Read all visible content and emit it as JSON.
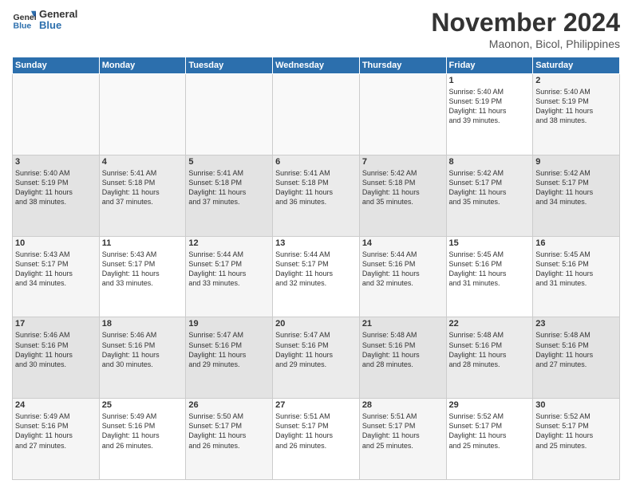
{
  "logo": {
    "line1": "General",
    "line2": "Blue"
  },
  "title": "November 2024",
  "subtitle": "Maonon, Bicol, Philippines",
  "days_header": [
    "Sunday",
    "Monday",
    "Tuesday",
    "Wednesday",
    "Thursday",
    "Friday",
    "Saturday"
  ],
  "weeks": [
    [
      {
        "day": "",
        "info": ""
      },
      {
        "day": "",
        "info": ""
      },
      {
        "day": "",
        "info": ""
      },
      {
        "day": "",
        "info": ""
      },
      {
        "day": "",
        "info": ""
      },
      {
        "day": "1",
        "info": "Sunrise: 5:40 AM\nSunset: 5:19 PM\nDaylight: 11 hours\nand 39 minutes."
      },
      {
        "day": "2",
        "info": "Sunrise: 5:40 AM\nSunset: 5:19 PM\nDaylight: 11 hours\nand 38 minutes."
      }
    ],
    [
      {
        "day": "3",
        "info": "Sunrise: 5:40 AM\nSunset: 5:19 PM\nDaylight: 11 hours\nand 38 minutes."
      },
      {
        "day": "4",
        "info": "Sunrise: 5:41 AM\nSunset: 5:18 PM\nDaylight: 11 hours\nand 37 minutes."
      },
      {
        "day": "5",
        "info": "Sunrise: 5:41 AM\nSunset: 5:18 PM\nDaylight: 11 hours\nand 37 minutes."
      },
      {
        "day": "6",
        "info": "Sunrise: 5:41 AM\nSunset: 5:18 PM\nDaylight: 11 hours\nand 36 minutes."
      },
      {
        "day": "7",
        "info": "Sunrise: 5:42 AM\nSunset: 5:18 PM\nDaylight: 11 hours\nand 35 minutes."
      },
      {
        "day": "8",
        "info": "Sunrise: 5:42 AM\nSunset: 5:17 PM\nDaylight: 11 hours\nand 35 minutes."
      },
      {
        "day": "9",
        "info": "Sunrise: 5:42 AM\nSunset: 5:17 PM\nDaylight: 11 hours\nand 34 minutes."
      }
    ],
    [
      {
        "day": "10",
        "info": "Sunrise: 5:43 AM\nSunset: 5:17 PM\nDaylight: 11 hours\nand 34 minutes."
      },
      {
        "day": "11",
        "info": "Sunrise: 5:43 AM\nSunset: 5:17 PM\nDaylight: 11 hours\nand 33 minutes."
      },
      {
        "day": "12",
        "info": "Sunrise: 5:44 AM\nSunset: 5:17 PM\nDaylight: 11 hours\nand 33 minutes."
      },
      {
        "day": "13",
        "info": "Sunrise: 5:44 AM\nSunset: 5:17 PM\nDaylight: 11 hours\nand 32 minutes."
      },
      {
        "day": "14",
        "info": "Sunrise: 5:44 AM\nSunset: 5:16 PM\nDaylight: 11 hours\nand 32 minutes."
      },
      {
        "day": "15",
        "info": "Sunrise: 5:45 AM\nSunset: 5:16 PM\nDaylight: 11 hours\nand 31 minutes."
      },
      {
        "day": "16",
        "info": "Sunrise: 5:45 AM\nSunset: 5:16 PM\nDaylight: 11 hours\nand 31 minutes."
      }
    ],
    [
      {
        "day": "17",
        "info": "Sunrise: 5:46 AM\nSunset: 5:16 PM\nDaylight: 11 hours\nand 30 minutes."
      },
      {
        "day": "18",
        "info": "Sunrise: 5:46 AM\nSunset: 5:16 PM\nDaylight: 11 hours\nand 30 minutes."
      },
      {
        "day": "19",
        "info": "Sunrise: 5:47 AM\nSunset: 5:16 PM\nDaylight: 11 hours\nand 29 minutes."
      },
      {
        "day": "20",
        "info": "Sunrise: 5:47 AM\nSunset: 5:16 PM\nDaylight: 11 hours\nand 29 minutes."
      },
      {
        "day": "21",
        "info": "Sunrise: 5:48 AM\nSunset: 5:16 PM\nDaylight: 11 hours\nand 28 minutes."
      },
      {
        "day": "22",
        "info": "Sunrise: 5:48 AM\nSunset: 5:16 PM\nDaylight: 11 hours\nand 28 minutes."
      },
      {
        "day": "23",
        "info": "Sunrise: 5:48 AM\nSunset: 5:16 PM\nDaylight: 11 hours\nand 27 minutes."
      }
    ],
    [
      {
        "day": "24",
        "info": "Sunrise: 5:49 AM\nSunset: 5:16 PM\nDaylight: 11 hours\nand 27 minutes."
      },
      {
        "day": "25",
        "info": "Sunrise: 5:49 AM\nSunset: 5:16 PM\nDaylight: 11 hours\nand 26 minutes."
      },
      {
        "day": "26",
        "info": "Sunrise: 5:50 AM\nSunset: 5:17 PM\nDaylight: 11 hours\nand 26 minutes."
      },
      {
        "day": "27",
        "info": "Sunrise: 5:51 AM\nSunset: 5:17 PM\nDaylight: 11 hours\nand 26 minutes."
      },
      {
        "day": "28",
        "info": "Sunrise: 5:51 AM\nSunset: 5:17 PM\nDaylight: 11 hours\nand 25 minutes."
      },
      {
        "day": "29",
        "info": "Sunrise: 5:52 AM\nSunset: 5:17 PM\nDaylight: 11 hours\nand 25 minutes."
      },
      {
        "day": "30",
        "info": "Sunrise: 5:52 AM\nSunset: 5:17 PM\nDaylight: 11 hours\nand 25 minutes."
      }
    ]
  ]
}
